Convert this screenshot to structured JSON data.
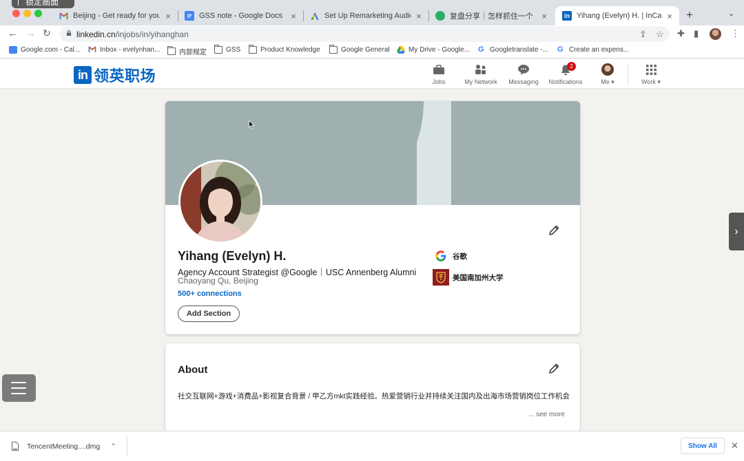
{
  "browser": {
    "overlay_label": "锁定画面",
    "tabs": [
      {
        "title": "Beijing - Get ready for your ha",
        "icon": "gmail-icon",
        "active": false
      },
      {
        "title": "GSS note - Google Docs",
        "icon": "docs-icon",
        "active": false
      },
      {
        "title": "Set Up Remarketing Audience",
        "icon": "ads-icon",
        "active": false
      },
      {
        "title": "复盘分享｜怎样抓住一个「相对",
        "icon": "wechat-icon",
        "active": false
      },
      {
        "title": "Yihang (Evelyn) H. | InCareer",
        "icon": "linkedin-icon",
        "active": true
      }
    ],
    "url_host": "linkedin.cn",
    "url_path": "/injobs/in/yihanghan",
    "bookmarks": [
      {
        "label": "Google.com - Cal...",
        "icon": "calendar-icon"
      },
      {
        "label": "Inbox - evelynhan...",
        "icon": "gmail-icon"
      },
      {
        "label": "内部规定",
        "icon": "folder-icon"
      },
      {
        "label": "GSS",
        "icon": "folder-icon"
      },
      {
        "label": "Product Knowledge",
        "icon": "folder-icon"
      },
      {
        "label": "Google General",
        "icon": "folder-icon"
      },
      {
        "label": "My Drive - Google...",
        "icon": "drive-icon"
      },
      {
        "label": "Googletranslate -...",
        "icon": "google-icon"
      },
      {
        "label": "Create an expens...",
        "icon": "google-icon"
      }
    ]
  },
  "header": {
    "logo_in": "in",
    "logo_text": "领英职场",
    "nav": [
      {
        "label": "Jobs",
        "icon": "briefcase-icon"
      },
      {
        "label": "My Network",
        "icon": "network-icon"
      },
      {
        "label": "Messaging",
        "icon": "messaging-icon"
      },
      {
        "label": "Notifications",
        "icon": "bell-icon",
        "badge": "2"
      },
      {
        "label": "Me",
        "icon": "avatar-icon"
      },
      {
        "label": "Work",
        "icon": "grid-icon"
      }
    ]
  },
  "profile": {
    "name": "Yihang (Evelyn) H.",
    "headline": "Agency Account Strategist @Google｜USC Annenberg Alumni",
    "location": "Chaoyang Qu, Beijing",
    "connections": "500+ connections",
    "add_section": "Add Section",
    "experience": [
      {
        "label": "谷歌",
        "icon": "google-logo-icon"
      },
      {
        "label": "美国南加州大学",
        "icon": "usc-logo-icon"
      }
    ]
  },
  "about": {
    "title": "About",
    "text": "社交互联网+游戏+消费品+影视复合背景 / 甲乙方mkt实践经验。热爱营销行业并持续关注国内及出海市场营销岗位工作机会",
    "see_more": "... see more"
  },
  "downloads": {
    "file": "TencentMeeting....dmg",
    "show_all": "Show All"
  },
  "colors": {
    "linkedin_blue": "#0a66c2",
    "cover_gray": "#a0afb0",
    "badge_red": "#cc1016"
  }
}
